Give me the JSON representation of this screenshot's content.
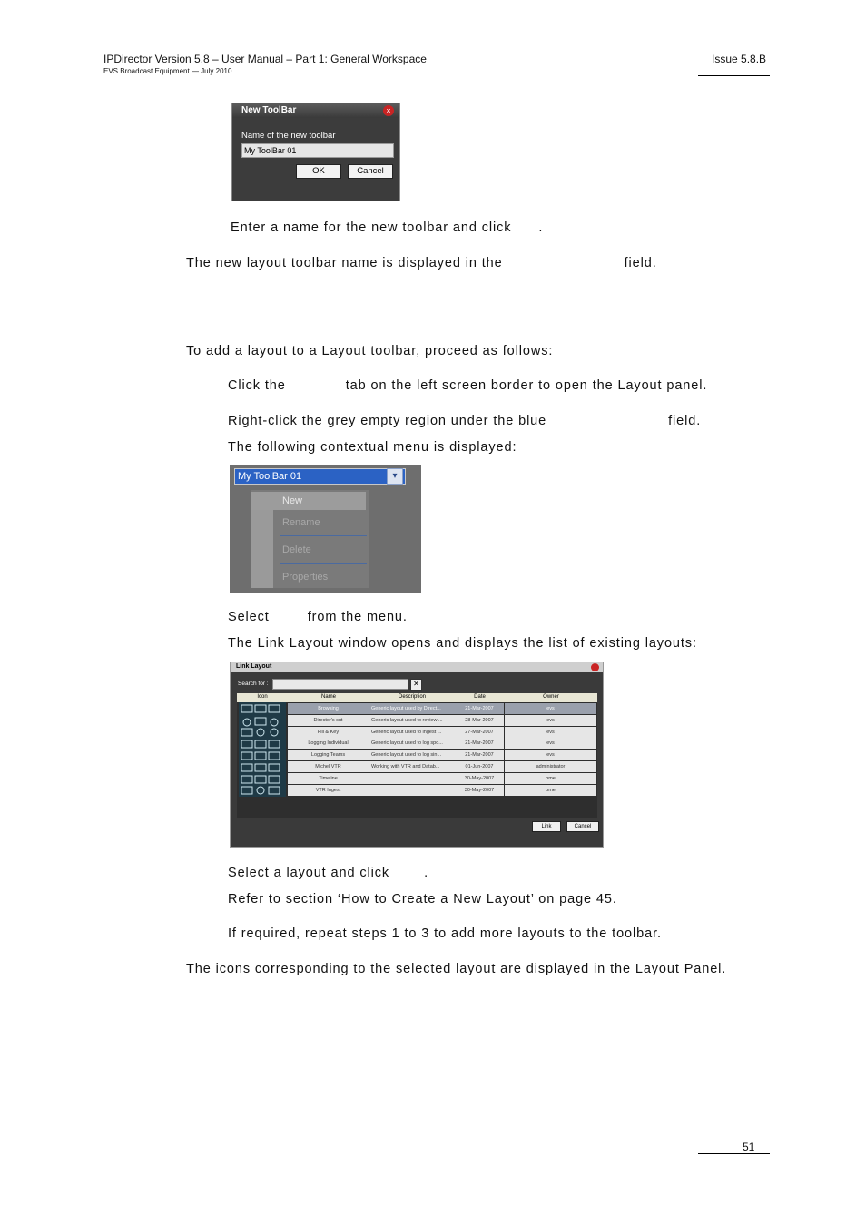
{
  "header": {
    "title": "IPDirector Version 5.8 – User Manual – Part 1: General Workspace",
    "subtitle": "EVS Broadcast Equipment  — July 2010",
    "issue": "Issue 5.8.B"
  },
  "new_toolbar_dialog": {
    "title": "New ToolBar",
    "label": "Name of the new toolbar",
    "value": "My ToolBar 01",
    "ok": "OK",
    "cancel": "Cancel"
  },
  "text": {
    "step_enter_name": "Enter a name for the new toolbar and click",
    "step_enter_name_end": ".",
    "result_name_a": "The new layout toolbar name is displayed in the",
    "result_name_b": "field.",
    "intro": "To add a layout to a Layout toolbar, proceed as follows:",
    "step1_a": "Click the",
    "step1_b": "tab on the left screen border to open the Layout panel.",
    "step2_a": "Right-click the",
    "step2_grey": "grey",
    "step2_b": "empty region under the blue",
    "step2_c": "field.",
    "step2_result": "The following contextual menu is displayed:",
    "step3_a": "Select",
    "step3_b": "from the menu.",
    "step3_result": "The Link Layout window opens and displays the list of existing layouts:",
    "step4_a": "Select a layout and click",
    "step4_b": ".",
    "step4_ref": "Refer to section ‘How to Create a New Layout’ on page 45.",
    "step5": "If required, repeat steps 1 to 3 to add more layouts to the toolbar.",
    "final": "The icons corresponding to the selected layout are displayed in the Layout Panel."
  },
  "context_menu": {
    "combo_value": "My ToolBar 01",
    "items": [
      "New",
      "Rename",
      "Delete",
      "Properties"
    ]
  },
  "link_layout": {
    "title": "Link Layout",
    "search_label": "Search for :",
    "columns": [
      "Icon",
      "Name",
      "Description",
      "Date",
      "Owner"
    ],
    "rows": [
      {
        "name": "Browsing",
        "description": "Generic layout used by Direct...",
        "date": "21-Mar-2007",
        "owner": "evs"
      },
      {
        "name": "Director's cut",
        "description": "Generic layout used to review ...",
        "date": "28-Mar-2007",
        "owner": "evs"
      },
      {
        "name": "Fill & Key",
        "description": "Generic layout used to ingest ...",
        "date": "27-Mar-2007",
        "owner": "evs"
      },
      {
        "name": "Logging Individual",
        "description": "Generic layout used to log spo...",
        "date": "21-Mar-2007",
        "owner": "evs"
      },
      {
        "name": "Logging Teams",
        "description": "Generic layout used to log sin...",
        "date": "21-Mar-2007",
        "owner": "evs"
      },
      {
        "name": "Michel VTR",
        "description": "Working with VTR and Datab...",
        "date": "01-Jun-2007",
        "owner": "administrator"
      },
      {
        "name": "Timeline",
        "description": "",
        "date": "30-May-2007",
        "owner": "pme"
      },
      {
        "name": "VTR Ingest",
        "description": "",
        "date": "30-May-2007",
        "owner": "pme"
      }
    ],
    "link": "Link",
    "cancel": "Cancel"
  },
  "footer": {
    "page_number": "51"
  }
}
